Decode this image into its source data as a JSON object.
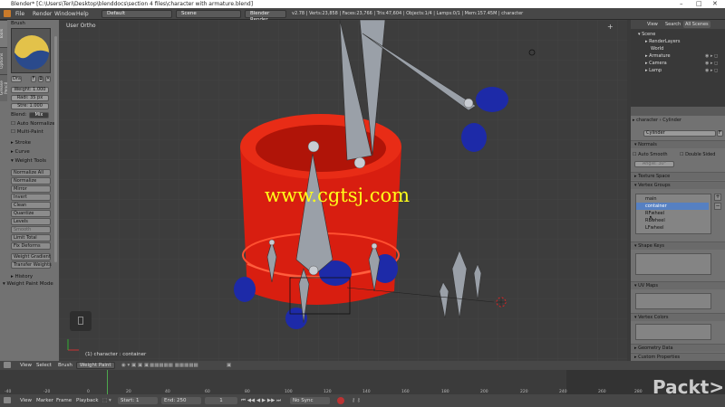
{
  "window": {
    "title": "Blender* [C:\\Users\\Teri\\Desktop\\blenddocs\\section 4 files\\character with armature.blend]"
  },
  "info_header": {
    "menus": [
      "File",
      "Render",
      "Window",
      "Help"
    ],
    "layout": "Default",
    "scene": "Scene",
    "engine": "Blender Render",
    "stats": "v2.78 | Verts:23,858 | Faces:23,766 | Tris:47,604 | Objects:1/4 | Lamps:0/1 | Mem:157.45M | character"
  },
  "tool_shelf": {
    "tabs": [
      "Tools",
      "Options",
      "Grease Pencil"
    ],
    "brush_header": "Brush",
    "brush_name": "Dra",
    "brush_f": "F",
    "weight": "Weight: 1.000",
    "radius": "Radi: 35 px",
    "strength": "Stre: 1.000",
    "blend_label": "Blend:",
    "blend_value": "Mix",
    "auto_normalize": "Auto Normalize",
    "multi_paint": "Multi-Paint",
    "stroke": "Stroke",
    "curve": "Curve",
    "weight_tools": "Weight Tools",
    "buttons": [
      "Normalize All",
      "Normalize",
      "Mirror",
      "Invert",
      "Clean",
      "Quantize",
      "Levels",
      "Smooth",
      "Limit Total",
      "Fix Deforms",
      "Weight Gradient",
      "Transfer Weights"
    ],
    "history": "History",
    "mode_label": "Weight Paint Mode"
  },
  "viewport": {
    "label": "User Ortho",
    "object_label": "(1) character : container",
    "watermark": "www.cgtsj.com"
  },
  "outliner": {
    "tabs": [
      "View",
      "Search",
      "All Scenes"
    ],
    "items": [
      "Scene",
      "RenderLayers",
      "World",
      "Armature",
      "Camera",
      "Lamp"
    ]
  },
  "properties": {
    "object_path": "character",
    "mesh_path": "Cylinder",
    "mesh_name": "Cylinder",
    "mesh_f": "F",
    "normals_hdr": "Normals",
    "auto_smooth": "Auto Smooth",
    "double_sided": "Double Sided",
    "angle": "Angle: 30°",
    "texture_space": "Texture Space",
    "vertex_groups_hdr": "Vertex Groups",
    "vertex_groups": [
      "main",
      "container",
      "RFwheel",
      "RBwheel",
      "LFwheel"
    ],
    "shape_keys": "Shape Keys",
    "uv_maps": "UV Maps",
    "vertex_colors": "Vertex Colors",
    "geometry_data": "Geometry Data",
    "custom_properties": "Custom Properties"
  },
  "view3d_header": {
    "items": [
      "View",
      "Select",
      "Brush"
    ],
    "mode": "Weight Paint"
  },
  "timeline": {
    "ruler": [
      "-40",
      "-20",
      "0",
      "20",
      "40",
      "60",
      "80",
      "100",
      "120",
      "140",
      "160",
      "180",
      "200",
      "220",
      "240",
      "260",
      "280"
    ],
    "menus": [
      "View",
      "Marker",
      "Frame",
      "Playback"
    ],
    "start": "Start: 1",
    "end": "End: 250",
    "current": "1",
    "sync": "No Sync"
  },
  "brand_logo": "Packt>"
}
